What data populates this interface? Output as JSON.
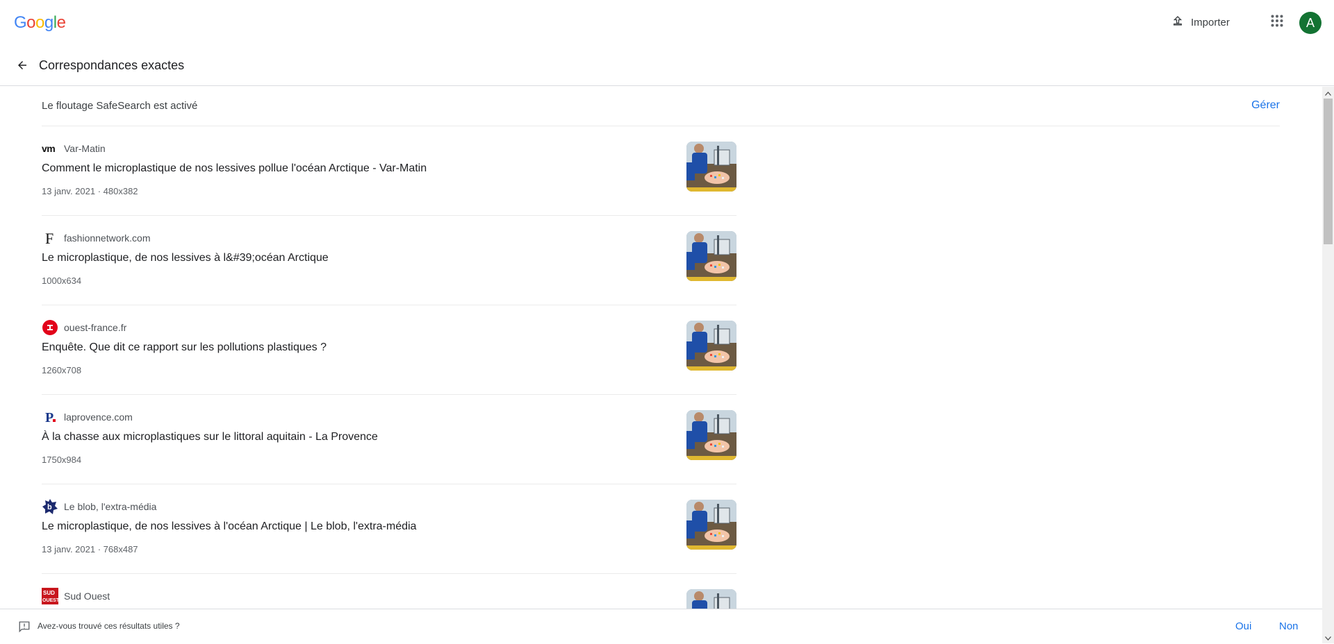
{
  "app": {
    "logo_letters": [
      "G",
      "o",
      "o",
      "g",
      "l",
      "e"
    ],
    "logo_colors": [
      "#4285F4",
      "#EA4335",
      "#FBBC05",
      "#4285F4",
      "#34A853",
      "#EA4335"
    ]
  },
  "topbar": {
    "import_label": "Importer",
    "avatar_initial": "A",
    "avatar_color": "#137333"
  },
  "header": {
    "title": "Correspondances exactes"
  },
  "safesearch": {
    "text": "Le floutage SafeSearch est activé",
    "manage_label": "Gérer"
  },
  "results": [
    {
      "source": "Var-Matin",
      "favicon": "vm",
      "title": "Comment le microplastique de nos lessives pollue l'océan Arctique - Var-Matin",
      "meta": "13 janv. 2021 · 480x382"
    },
    {
      "source": "fashionnetwork.com",
      "favicon": "F",
      "title": "Le microplastique, de nos lessives à l&#39;océan Arctique",
      "meta": "1000x634"
    },
    {
      "source": "ouest-france.fr",
      "favicon": "ouest-france-logo",
      "title": "Enquête. Que dit ce rapport sur les pollutions plastiques ?",
      "meta": "1260x708"
    },
    {
      "source": "laprovence.com",
      "favicon": "P",
      "title": "À la chasse aux microplastiques sur le littoral aquitain - La Provence",
      "meta": "1750x984"
    },
    {
      "source": "Le blob, l'extra-média",
      "favicon": "b",
      "title": "Le microplastique, de nos lessives à l'océan Arctique | Le blob, l'extra-média",
      "meta": "13 janv. 2021 · 768x487"
    },
    {
      "source": "Sud Ouest",
      "favicon": "SUD OUEST",
      "title": "",
      "meta": ""
    }
  ],
  "feedback": {
    "question": "Avez-vous trouvé ces résultats utiles ?",
    "yes_label": "Oui",
    "no_label": "Non"
  }
}
